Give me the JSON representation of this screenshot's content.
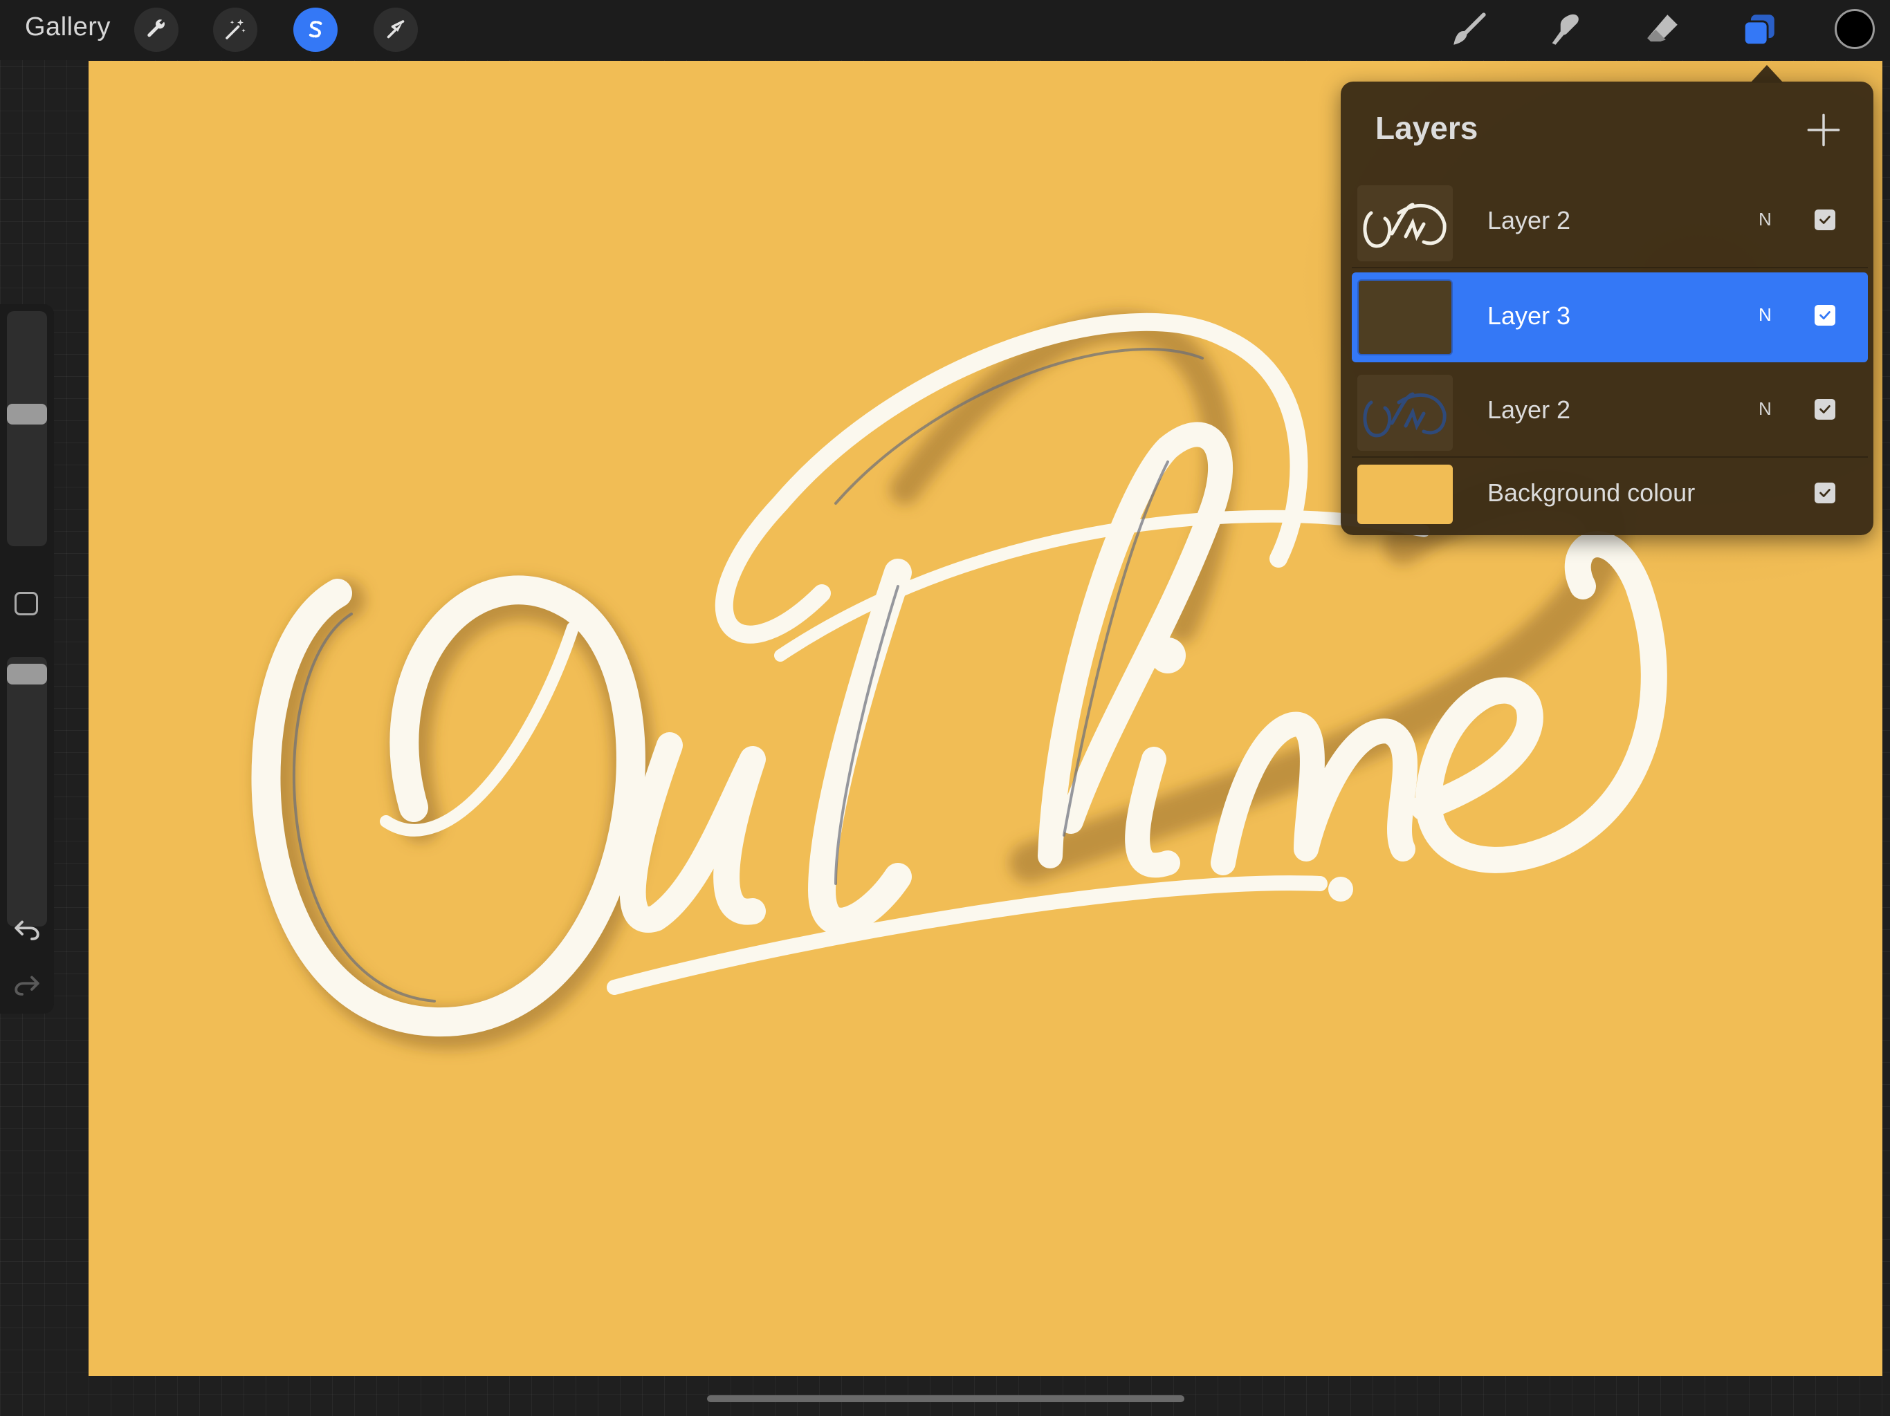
{
  "app": {
    "gallery_label": "Gallery",
    "accent_color": "#3478f6",
    "canvas_color": "#f1bd55",
    "current_color": "#000000"
  },
  "toolbar": {
    "left_tools": [
      {
        "name": "actions",
        "icon": "wrench-icon"
      },
      {
        "name": "adjustments",
        "icon": "magic-wand-icon"
      },
      {
        "name": "selection",
        "icon": "selection-s-icon",
        "active": true
      },
      {
        "name": "transform",
        "icon": "arrow-cursor-icon"
      }
    ],
    "right_tools": [
      {
        "name": "brush",
        "icon": "brush-icon"
      },
      {
        "name": "smudge",
        "icon": "smudge-icon"
      },
      {
        "name": "eraser",
        "icon": "eraser-icon"
      },
      {
        "name": "layers",
        "icon": "layers-icon",
        "active": true
      }
    ]
  },
  "sidebar": {
    "brush_size_slider": {
      "value": 0.57
    },
    "opacity_slider": {
      "value": 1.0
    },
    "modify_button": "square-icon",
    "undo": "undo-icon",
    "redo": "redo-icon"
  },
  "canvas": {
    "artwork": "Outline"
  },
  "layers_panel": {
    "title": "Layers",
    "add_icon": "plus-icon",
    "layers": [
      {
        "name": "Layer 2",
        "blend": "N",
        "visible": true,
        "selected": false,
        "thumb": "lettering-white"
      },
      {
        "name": "Layer 3",
        "blend": "N",
        "visible": true,
        "selected": true,
        "thumb": "shadow-dark"
      },
      {
        "name": "Layer 2",
        "blend": "N",
        "visible": true,
        "selected": false,
        "thumb": "lettering-blue"
      },
      {
        "name": "Background colour",
        "visible": true,
        "selected": false,
        "thumb": "solid-yellow"
      }
    ]
  }
}
